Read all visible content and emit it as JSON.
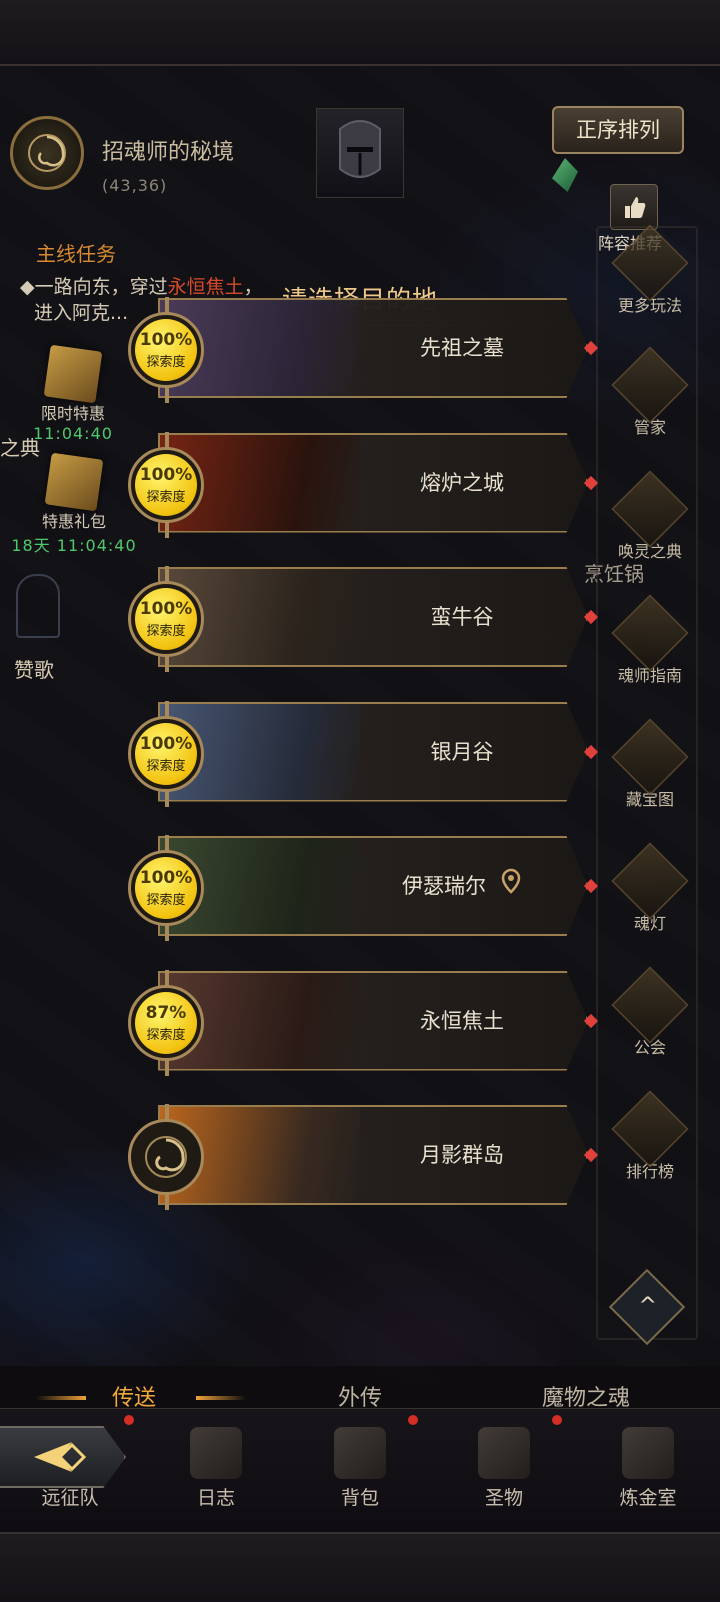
{
  "header": {
    "zone_name": "招魂师的秘境",
    "coords": "(43,36)",
    "sort_button": "正序排列",
    "team_recommend": "阵容推荐"
  },
  "quest": {
    "title": "主线任务",
    "line1_prefix": "一路向东，穿过",
    "line1_highlight": "永恒焦土",
    "line1_suffix": "，",
    "line2": "进入阿克..."
  },
  "left_widgets": {
    "limited_sale": {
      "label": "限时特惠",
      "timer": "11:04:40"
    },
    "special_gift": {
      "label": "特惠礼包",
      "timer": "18天 11:04:40"
    },
    "hymn": "赞歌",
    "codex_partial": "之典"
  },
  "right_menu": [
    {
      "label": "更多玩法",
      "icon": "gift-icon"
    },
    {
      "label": "管家",
      "icon": "quill-icon"
    },
    {
      "label": "唤灵之典",
      "icon": "book-icon"
    },
    {
      "label": "魂师指南",
      "icon": "compass-icon"
    },
    {
      "label": "藏宝图",
      "icon": "map-scroll-icon"
    },
    {
      "label": "魂灯",
      "icon": "lamp-icon"
    },
    {
      "label": "公会",
      "icon": "guild-crest-icon"
    },
    {
      "label": "排行榜",
      "icon": "trophy-icon"
    }
  ],
  "map_labels": {
    "cookpot": "烹饪锅"
  },
  "modal": {
    "title": "请选择目的地",
    "destinations": [
      {
        "name": "先祖之墓",
        "progress": "100%",
        "progress_label": "探索度",
        "art": [
          "#4c3c5c",
          "#2a2436"
        ]
      },
      {
        "name": "熔炉之城",
        "progress": "100%",
        "progress_label": "探索度",
        "art": [
          "#7a2412",
          "#2a120c"
        ]
      },
      {
        "name": "蛮牛谷",
        "progress": "100%",
        "progress_label": "探索度",
        "art": [
          "#5b4a3c",
          "#2b231c"
        ]
      },
      {
        "name": "银月谷",
        "progress": "100%",
        "progress_label": "探索度",
        "art": [
          "#4a5a78",
          "#252b3a"
        ]
      },
      {
        "name": "伊瑟瑞尔",
        "progress": "100%",
        "progress_label": "探索度",
        "art": [
          "#3a4a30",
          "#1e2419"
        ],
        "current_location": true
      },
      {
        "name": "永恒焦土",
        "progress": "87%",
        "progress_label": "探索度",
        "art": [
          "#5a3a30",
          "#2a1a16"
        ]
      },
      {
        "name": "月影群岛",
        "progress": "",
        "progress_label": "",
        "art": [
          "#c46a1c",
          "#3a2a20"
        ],
        "locked_emblem": true
      }
    ]
  },
  "tabs": [
    {
      "label": "传送",
      "active": true
    },
    {
      "label": "外传",
      "active": false
    },
    {
      "label": "魔物之魂",
      "active": false
    }
  ],
  "bottom_nav": [
    {
      "label": "远征队",
      "badge": true
    },
    {
      "label": "日志",
      "badge": false
    },
    {
      "label": "背包",
      "badge": true
    },
    {
      "label": "圣物",
      "badge": true
    },
    {
      "label": "炼金室",
      "badge": false
    }
  ],
  "colors": {
    "accent": "#f2a93b",
    "gold": "#9a7d4c",
    "badge_red": "#d32d25",
    "timer_green": "#4fc86c"
  }
}
